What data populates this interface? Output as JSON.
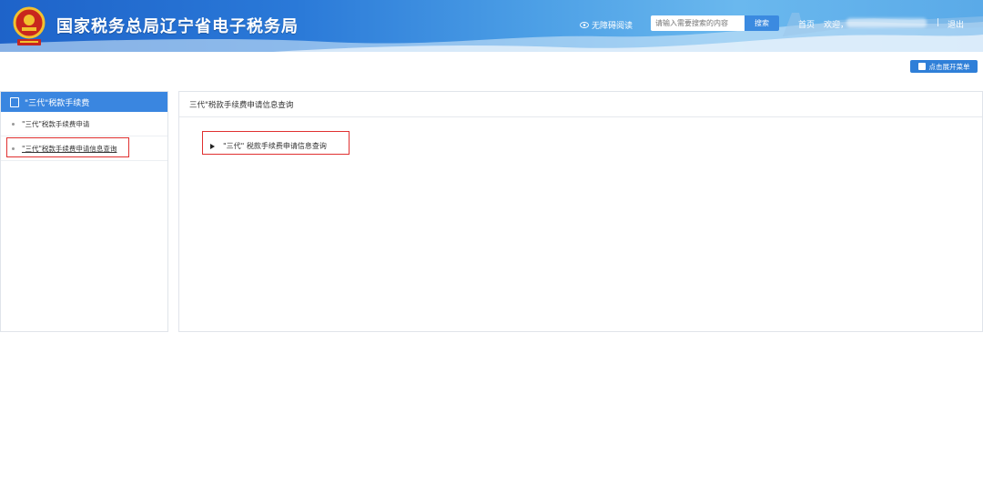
{
  "header": {
    "title": "国家税务总局辽宁省电子税务局",
    "accessible_reading": "无障碍阅读",
    "search_placeholder": "请输入需要搜索的内容",
    "search_button": "搜索",
    "home": "首页",
    "welcome": "欢迎，",
    "separator": "|",
    "logout": "退出"
  },
  "toolbar": {
    "expand_menu": "点击展开菜单"
  },
  "sidebar": {
    "title": "\"三代\"税款手续费",
    "items": [
      {
        "label": "\"三代\"税款手续费申请"
      },
      {
        "label": "\"三代\"税款手续费申请信息查询"
      }
    ]
  },
  "panel": {
    "title": "三代\"税款手续费申请信息查询",
    "tree_item": "\"三代\" 税款手续费申请信息查询"
  },
  "colors": {
    "header_blue": "#1e63c9",
    "accent": "#3a86e0",
    "highlight": "#e03030"
  }
}
